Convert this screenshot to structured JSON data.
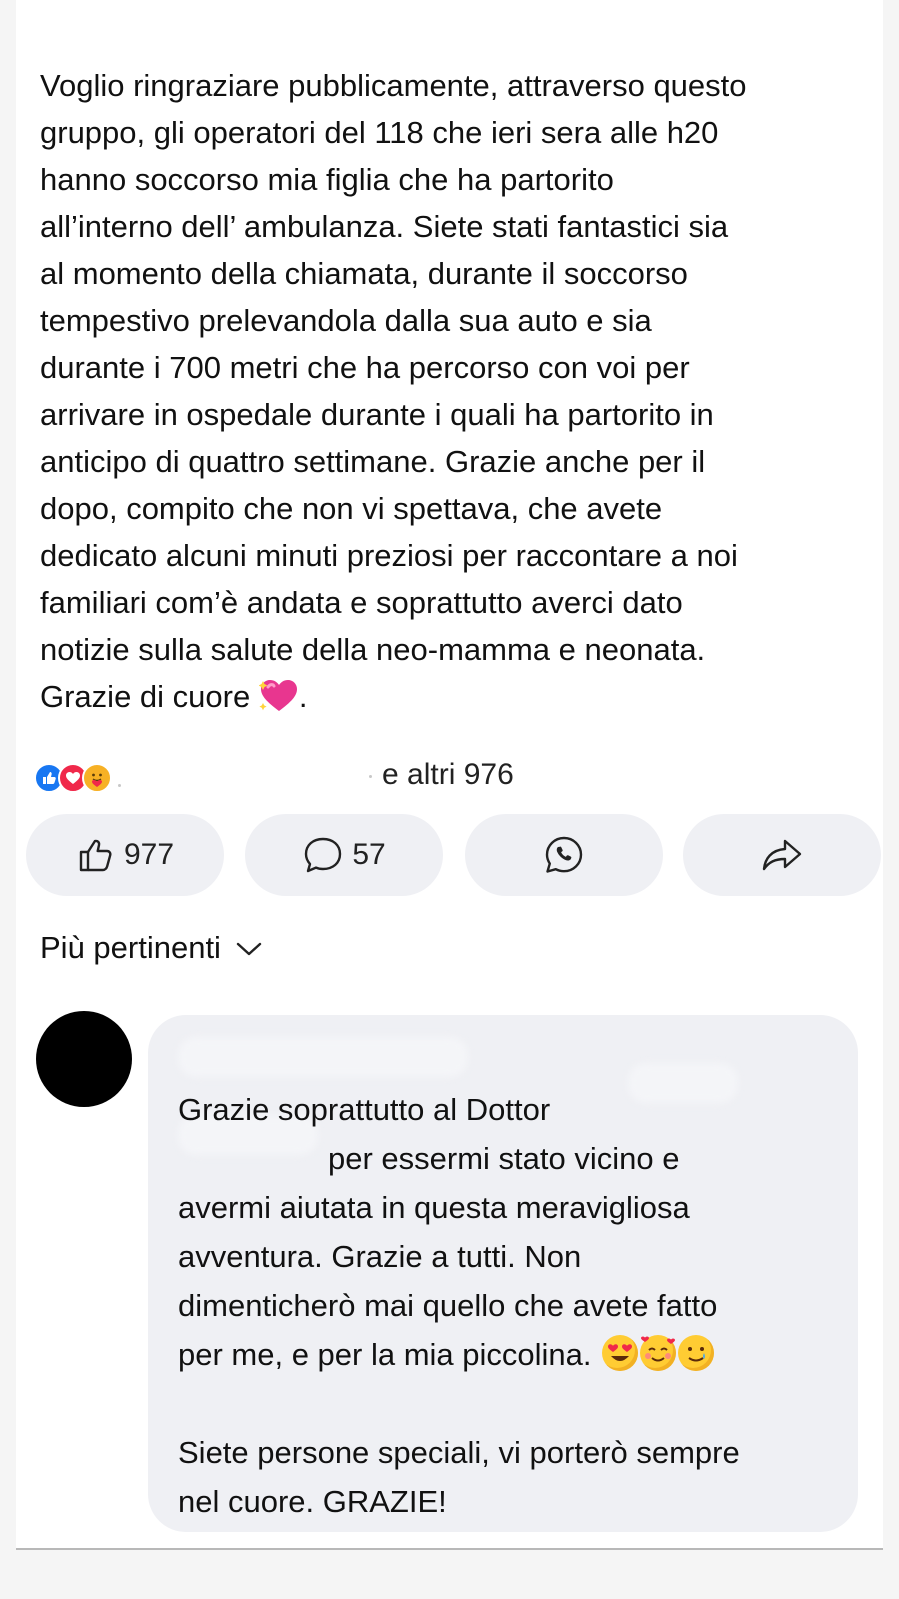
{
  "post": {
    "lines": [
      "Voglio ringraziare pubblicamente, attraverso questo",
      "gruppo, gli operatori del 118 che ieri sera alle h20",
      "hanno soccorso mia figlia che ha partorito",
      "all’interno dell’ ambulanza. Siete stati fantastici sia",
      "al momento della chiamata, durante il soccorso",
      "tempestivo prelevandola dalla sua auto e sia",
      "durante i 700 metri che ha percorso con voi per",
      "arrivare in ospedale durante i quali ha partorito in",
      "anticipo di quattro settimane. Grazie anche per il",
      "dopo, compito che non vi spettava, che avete",
      "dedicato alcuni minuti preziosi per raccontare a noi",
      "familiari com’è andata e soprattutto averci dato",
      "notizie sulla salute della neo-mamma e neonata.",
      "Grazie di cuore"
    ],
    "last_line_suffix": ".",
    "heart_emoji": "sparkling-heart"
  },
  "reactions": {
    "icons": [
      "like-reaction",
      "love-reaction",
      "care-reaction"
    ],
    "others_label": "e altri 976"
  },
  "actions": {
    "like_count": "977",
    "comment_count": "57"
  },
  "sort": {
    "label": "Più pertinenti"
  },
  "comment": {
    "lines": [
      "Grazie soprattutto al Dottor",
      "per essermi stato vicino e",
      "avermi aiutata in questa meravigliosa",
      "avventura. Grazie a tutti. Non",
      "dimenticherò mai quello che avete fatto",
      "per me, e per la mia piccolina."
    ],
    "closing_lines": [
      "Siete persone speciali, vi porterò sempre",
      "nel cuore. GRAZIE!"
    ],
    "emojis": [
      "heart-eyes-emoji",
      "smiling-face-with-hearts-emoji",
      "smiling-face-with-tear-emoji"
    ]
  },
  "colors": {
    "like_blue": "#1877f2",
    "love_red": "#f0284a",
    "care_yellow": "#f7b125",
    "pill_bg": "#eff0f4",
    "heart_pink": "#e8368f"
  }
}
